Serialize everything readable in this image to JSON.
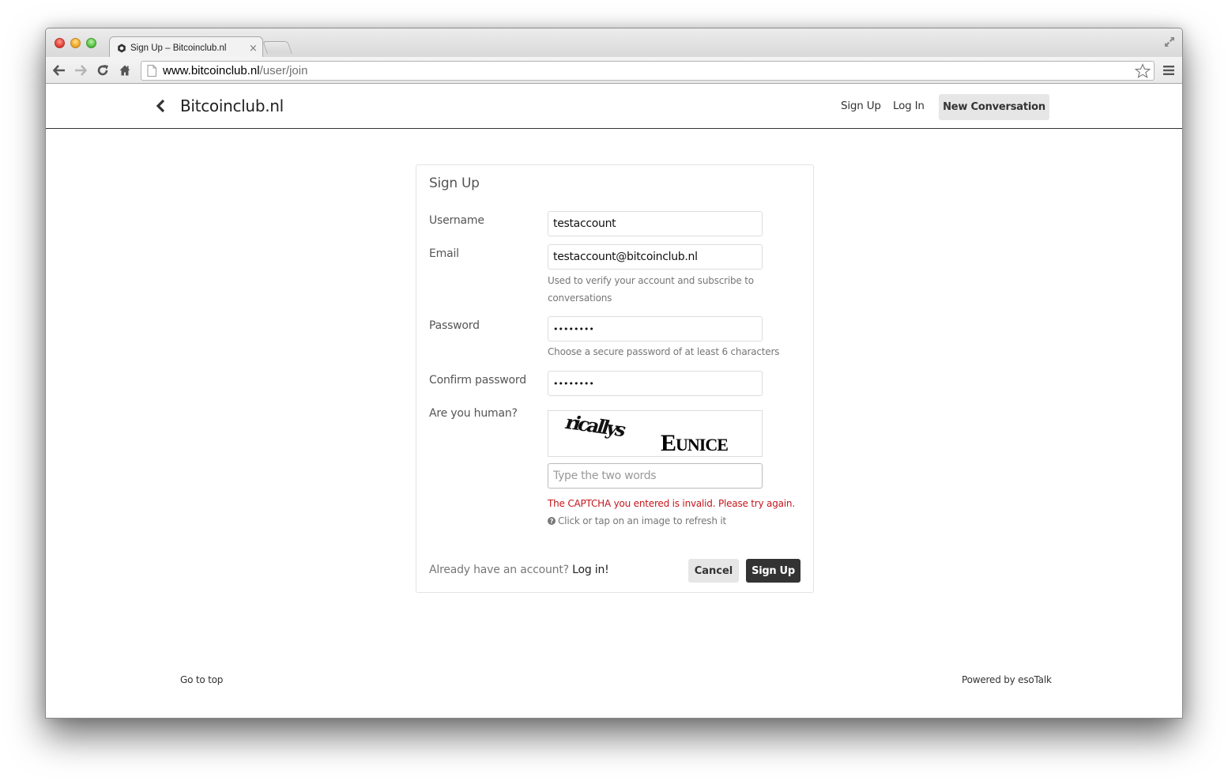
{
  "browser": {
    "tab_title": "Sign Up – Bitcoinclub.nl",
    "tab_close": "×",
    "url_host": "www.bitcoinclub.nl",
    "url_path": "/user/join",
    "icons": [
      "back-arrow-icon",
      "forward-arrow-icon",
      "reload-icon",
      "home-icon",
      "page-icon",
      "star-icon",
      "menu-icon",
      "fullscreen-icon"
    ]
  },
  "header": {
    "back_icon": "chevron-left-icon",
    "brand": "Bitcoinclub.nl",
    "links": {
      "sign_up": "Sign Up",
      "log_in": "Log In",
      "new_conversation": "New Conversation"
    }
  },
  "form": {
    "title": "Sign Up",
    "username": {
      "label": "Username",
      "value": "testaccount"
    },
    "email": {
      "label": "Email",
      "value": "testaccount@bitcoinclub.nl",
      "help": "Used to verify your account and subscribe to conversations"
    },
    "password": {
      "label": "Password",
      "value": "••••••••",
      "help": "Choose a secure password of at least 6 characters"
    },
    "confirm_password": {
      "label": "Confirm password",
      "value": "••••••••"
    },
    "captcha": {
      "label": "Are you human?",
      "word1": "ricallys",
      "word2_initial": "E",
      "word2_rest": "UNICE",
      "input_value": "",
      "placeholder": "Type the two words",
      "error": "The CAPTCHA you entered is invalid. Please try again.",
      "refresh_hint": "Click or tap on an image to refresh it"
    },
    "footer_prompt": "Already have an account?",
    "login_link": "Log in!",
    "cancel_label": "Cancel",
    "submit_label": "Sign Up"
  },
  "page_footer": {
    "go_to_top": "Go to top",
    "powered_by": "Powered by esoTalk"
  }
}
